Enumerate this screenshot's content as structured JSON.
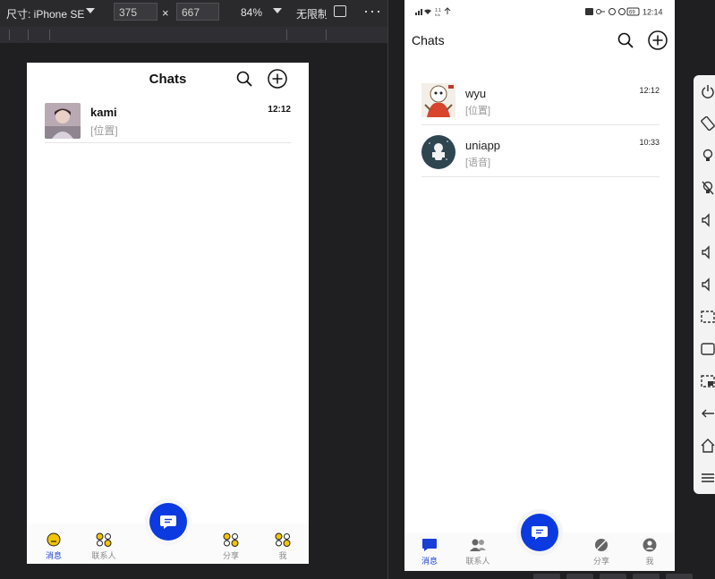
{
  "devtools": {
    "device_label": "尺寸: iPhone SE",
    "width": "375",
    "height": "667",
    "times": "×",
    "zoom": "84%",
    "throttle": "无限制",
    "more": "···"
  },
  "sim": {
    "title": "Chats",
    "chats": [
      {
        "name": "kami",
        "time": "12:12",
        "preview": "[位置]"
      }
    ],
    "tabs": {
      "messages": "消息",
      "contacts": "联系人",
      "share": "分享",
      "me": "我"
    }
  },
  "device": {
    "status_left": "ᴴᴰ ⌔ 1.1 K/s ⚲",
    "status_right": "HD ⊶ ⏰ 69 12:14",
    "battery": "69",
    "clock": "12:14",
    "title": "Chats",
    "chats": [
      {
        "name": "wyu",
        "time": "12:12",
        "preview": "[位置]"
      },
      {
        "name": "uniapp",
        "time": "10:33",
        "preview": "[语音]"
      }
    ],
    "tabs": {
      "messages": "消息",
      "contacts": "联系人",
      "share": "分享",
      "me": "我"
    }
  },
  "colors": {
    "accent": "#0b3ae0",
    "tab_active": "#1a3fd6",
    "yellow": "#f2c400"
  }
}
